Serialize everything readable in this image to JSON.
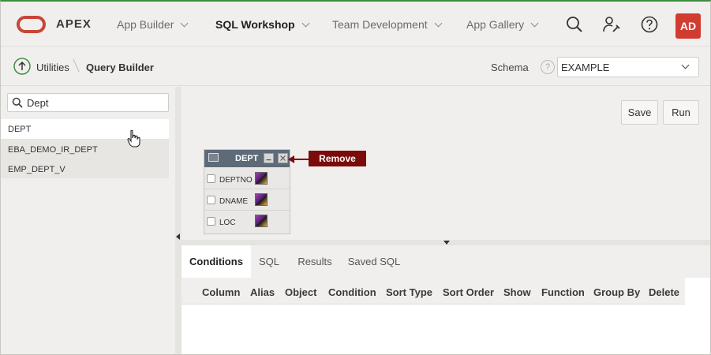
{
  "header": {
    "brand": "APEX",
    "nav": [
      {
        "label": "App Builder"
      },
      {
        "label": "SQL Workshop"
      },
      {
        "label": "Team Development"
      },
      {
        "label": "App Gallery"
      }
    ],
    "avatar": "AD"
  },
  "breadcrumb": {
    "parent": "Utilities",
    "current": "Query Builder"
  },
  "schema": {
    "label": "Schema",
    "help": "?",
    "value": "EXAMPLE"
  },
  "search": {
    "value": "Dept"
  },
  "tables": [
    "DEPT",
    "EBA_DEMO_IR_DEPT",
    "EMP_DEPT_V"
  ],
  "actions": {
    "save": "Save",
    "run": "Run"
  },
  "dept_widget": {
    "name": "DEPT",
    "columns": [
      "DEPTNO",
      "DNAME",
      "LOC"
    ]
  },
  "remove_tooltip": "Remove",
  "tabs": [
    "Conditions",
    "SQL",
    "Results",
    "Saved SQL"
  ],
  "condition_columns": [
    "Column",
    "Alias",
    "Object",
    "Condition",
    "Sort Type",
    "Sort Order",
    "Show",
    "Function",
    "Group By",
    "Delete"
  ],
  "colors": {
    "brand_red": "#c74634",
    "avatar_bg": "#d13c30",
    "tooltip_bg": "#7b0a0a",
    "widget_title_bg": "#5e6a78"
  },
  "icons": {
    "search": "search-icon",
    "admin": "wrench-person-icon",
    "help": "help-icon",
    "up": "up-arrow-icon"
  }
}
